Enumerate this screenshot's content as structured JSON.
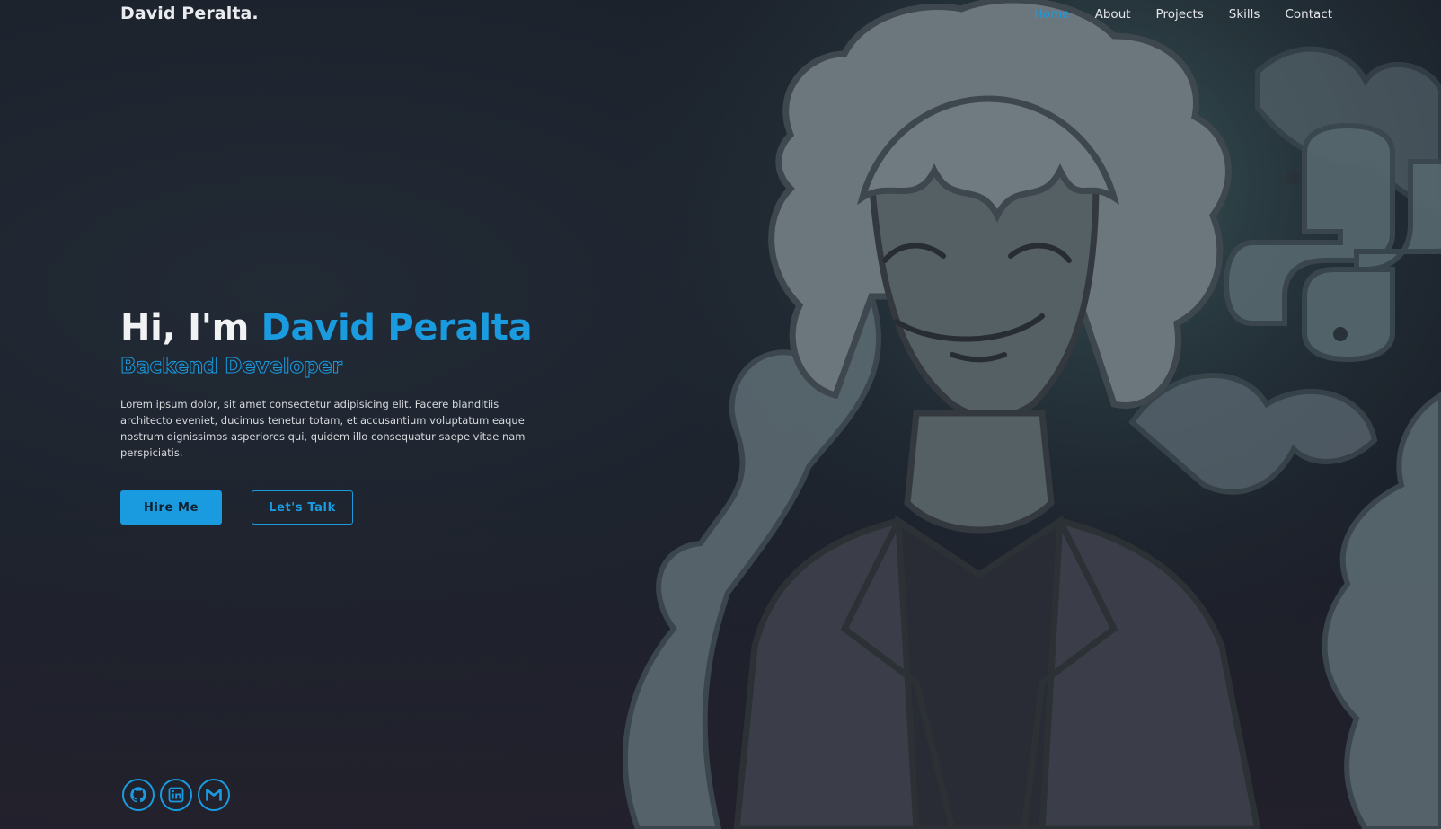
{
  "header": {
    "logo": "David Peralta.",
    "nav": [
      {
        "label": "Home",
        "active": true
      },
      {
        "label": "About",
        "active": false
      },
      {
        "label": "Projects",
        "active": false
      },
      {
        "label": "Skills",
        "active": false
      },
      {
        "label": "Contact",
        "active": false
      }
    ]
  },
  "hero": {
    "greeting": "Hi, I'm ",
    "name": "David Peralta",
    "role": "Backend Developer",
    "intro": "Lorem ipsum dolor, sit amet consectetur adipisicing elit. Facere blanditiis architecto eveniet, ducimus tenetur totam, et accusantium voluptatum eaque nostrum dignissimos asperiores qui, quidem illo consequatur saepe vitae nam perspiciatis.",
    "buttons": {
      "primary": "Hire Me",
      "secondary": "Let's Talk"
    }
  },
  "social": [
    {
      "icon": "github-icon"
    },
    {
      "icon": "linkedin-icon"
    },
    {
      "icon": "gmail-icon"
    }
  ],
  "colors": {
    "accent": "#1a9be0",
    "background": "#1c222c",
    "text": "#e6e8ec"
  }
}
